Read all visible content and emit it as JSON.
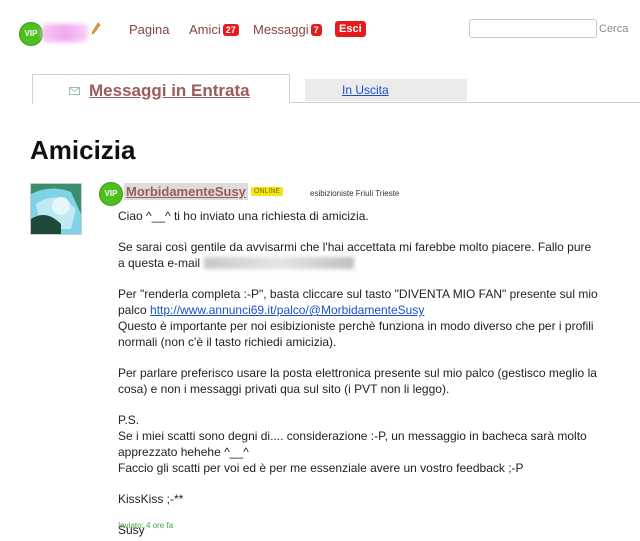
{
  "header": {
    "vip": "VIP",
    "nav": [
      {
        "label": "Pagina"
      },
      {
        "label": "Amici",
        "badge": "27"
      },
      {
        "label": "Messaggi",
        "badge": "7"
      }
    ],
    "logout": "Esci",
    "search_value": "",
    "search_button": "Cerca"
  },
  "tabs": {
    "inbox": "Messaggi in Entrata",
    "outbox": "In Uscita"
  },
  "page_title": "Amicizia",
  "message": {
    "vip": "VIP",
    "sender": "MorbidamenteSusy",
    "status": "ONLINE",
    "category": "esibizioniste Friuli Trieste",
    "greeting": "Ciao ^__^ ti ho inviato una richiesta di amicizia.",
    "p1": "Se sarai così gentile da avvisarmi che l'hai accettata mi farebbe molto piacere. Fallo pure a questa e-mail",
    "p2a": "Per \"renderla completa :-P\", basta cliccare sul tasto \"DIVENTA MIO FAN\" presente sul mio palco",
    "link": "http://www.annunci69.it/palco/@MorbidamenteSusy",
    "p2b": "Questo è importante per noi esibizioniste perchè funziona in modo diverso che per i profili normali (non c'è il tasto richiedi amicizia).",
    "p3": "Per parlare preferisco usare la posta elettronica presente sul mio palco (gestisco meglio la cosa) e non i messaggi privati qua sul sito (i PVT non li leggo).",
    "ps_label": "P.S.",
    "ps1": "Se i miei scatti sono degni di.... considerazione :-P, un messaggio in bacheca sarà molto apprezzato hehehe ^__^",
    "ps2": "Faccio gli scatti per voi ed è per me essenziale avere un vostro feedback ;-P",
    "kiss": "KissKiss ;-**",
    "signature": "Susy",
    "sent": "Inviato: 4 ore fa"
  }
}
